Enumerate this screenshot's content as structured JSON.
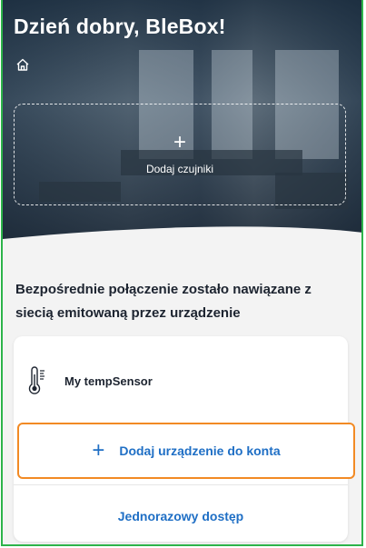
{
  "header": {
    "greeting": "Dzień dobry, BleBox!",
    "home_icon": "home-icon",
    "add_sensors_label": "Dodaj czujniki",
    "add_sensors_icon": "plus-icon"
  },
  "connection": {
    "message": "Bezpośrednie połączenie zostało nawiązane z siecią emitowaną przez urządzenie"
  },
  "device": {
    "name": "My tempSensor",
    "icon": "thermometer-icon"
  },
  "actions": {
    "add_device_label": "Dodaj urządzenie do konta",
    "add_device_icon": "plus-icon",
    "one_time_access_label": "Jednorazowy dostęp"
  },
  "colors": {
    "accent_blue": "#1f6fc5",
    "highlight_orange": "#f28a24",
    "frame_green": "#2db34a"
  }
}
